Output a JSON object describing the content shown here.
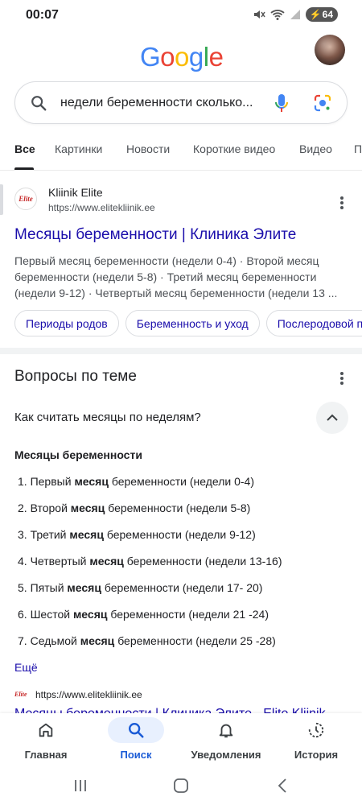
{
  "status_bar": {
    "time": "00:07",
    "battery": "64"
  },
  "search": {
    "query": "недели беременности сколько..."
  },
  "tabs": [
    {
      "label": "Все"
    },
    {
      "label": "Картинки"
    },
    {
      "label": "Новости"
    },
    {
      "label": "Короткие видео"
    },
    {
      "label": "Видео"
    },
    {
      "label": "П"
    }
  ],
  "result": {
    "favicon_text": "Elite",
    "site_name": "Kliinik Elite",
    "url": "https://www.elitekliinik.ee",
    "title": "Месяцы беременности | Клиника Элите",
    "snippet": "Первый месяц беременности (недели 0-4) · Второй месяц беременности (недели 5-8) · Третий месяц беременности (недели 9-12) · Четвертый месяц беременности (недели 13 ...",
    "chips": [
      "Периоды родов",
      "Беременность и уход",
      "Послеродовой п"
    ]
  },
  "questions": {
    "heading": "Вопросы по теме",
    "question": "Как считать месяцы по неделям?",
    "answer_heading": "Месяцы беременности",
    "items": [
      {
        "num": "1.",
        "pre": "Первый",
        "bold": "месяц",
        "post": "беременности (недели 0-4)"
      },
      {
        "num": "2.",
        "pre": "Второй",
        "bold": "месяц",
        "post": "беременности (недели 5-8)"
      },
      {
        "num": "3.",
        "pre": "Третий",
        "bold": "месяц",
        "post": "беременности (недели 9-12)"
      },
      {
        "num": "4.",
        "pre": "Четвертый",
        "bold": "месяц",
        "post": "беременности (недели 13-16)"
      },
      {
        "num": "5.",
        "pre": "Пятый",
        "bold": "месяц",
        "post": "беременности (недели 17- 20)"
      },
      {
        "num": "6.",
        "pre": "Шестой",
        "bold": "месяц",
        "post": "беременности (недели 21 -24)"
      },
      {
        "num": "7.",
        "pre": "Седьмой",
        "bold": "месяц",
        "post": "беременности (недели 25 -28)"
      }
    ],
    "more_label": "Ещё",
    "source_favicon_text": "Elite",
    "source_url": "https://www.elitekliinik.ee",
    "source_title": "Месяцы беременности | Клиника Элите - Elite Kliinik"
  },
  "bottom_nav": [
    {
      "label": "Главная",
      "icon": "home-icon"
    },
    {
      "label": "Поиск",
      "icon": "search-icon"
    },
    {
      "label": "Уведомления",
      "icon": "bell-icon"
    },
    {
      "label": "История",
      "icon": "history-icon"
    }
  ],
  "colors": {
    "link": "#1a0dab",
    "active_nav": "#1a5bd6",
    "active_pill": "#e8f0fe"
  }
}
